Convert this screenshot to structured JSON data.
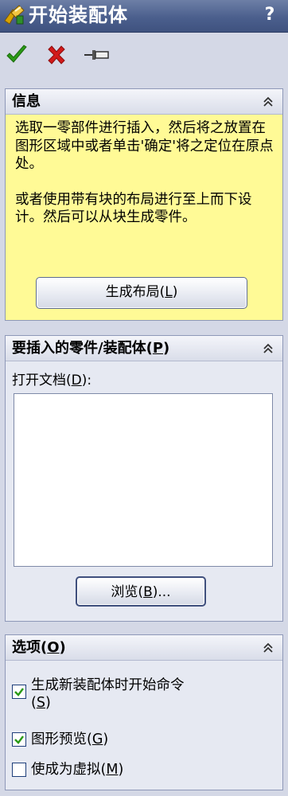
{
  "title": "开始装配体",
  "help_label": "?",
  "colors": {
    "ok": "#2a9a16",
    "cancel": "#d21a1a",
    "info_bg": "#fffa96",
    "title_bg": "#4b5f8d"
  },
  "actions": {
    "ok_icon": "green-check-icon",
    "cancel_icon": "red-x-icon",
    "pin_icon": "pushpin-icon"
  },
  "info": {
    "title": "信息",
    "paragraph1": "选取一零部件进行插入，然后将之放置在图形区域中或者单击'确定'将之定位在原点处。",
    "paragraph2": "或者使用带有块的布局进行至上而下设计。然后可以从块生成零件。",
    "layout_button": {
      "text": "生成布局(",
      "key": "L",
      "end": ")"
    }
  },
  "parts": {
    "title": {
      "text": "要插入的零件/装配体(",
      "key": "P",
      "end": ")"
    },
    "open_docs_label": {
      "text": "打开文档(",
      "key": "D",
      "end": "):"
    },
    "open_docs_items": [],
    "browse_button": {
      "text": "浏览(",
      "key": "B",
      "end": ")..."
    }
  },
  "options": {
    "title": {
      "text": "选项(",
      "key": "O",
      "end": ")"
    },
    "items": [
      {
        "line1": "生成新装配体时开始命令",
        "line2_pre": "(",
        "key": "S",
        "end": ")",
        "checked": true
      },
      {
        "line1": "图形预览(",
        "key": "G",
        "end": ")",
        "checked": true
      },
      {
        "line1": "使成为虚拟(",
        "key": "M",
        "end": ")",
        "checked": false
      }
    ]
  }
}
